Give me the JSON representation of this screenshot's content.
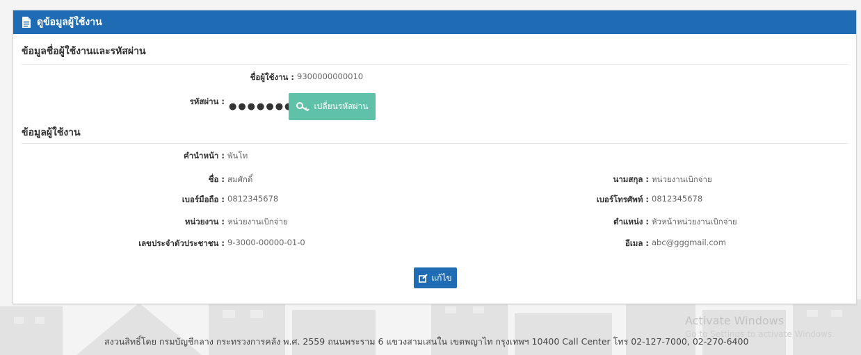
{
  "panel": {
    "title": "ดูข้อมูลผู้ใช้งาน"
  },
  "account_section": {
    "title": "ข้อมูลชื่อผู้ใช้งานและรหัสผ่าน",
    "username_label": "ชื่อผู้ใช้งาน :",
    "username_value": "9300000000010",
    "password_label": "รหัสผ่าน :",
    "password_mask": "●●●●●●●●",
    "change_password_button": "เปลี่ยนรหัสผ่าน"
  },
  "user_section": {
    "title": "ข้อมูลผู้ใช้งาน",
    "title_label": "คำนำหน้า :",
    "title_value": "พันโท",
    "firstname_label": "ชื่อ :",
    "firstname_value": "สมศักดิ์",
    "lastname_label": "นามสกุล :",
    "lastname_value": "หน่วยงานเบิกจ่าย",
    "mobile_label": "เบอร์มือถือ :",
    "mobile_value": "0812345678",
    "phone_label": "เบอร์โทรศัพท์ :",
    "phone_value": "0812345678",
    "agency_label": "หน่วยงาน :",
    "agency_value": "หน่วยงานเบิกจ่าย",
    "position_label": "ตำแหน่ง :",
    "position_value": "หัวหน้าหน่วยงานเบิกจ่าย",
    "citizen_id_label": "เลขประจำตัวประชาชน :",
    "citizen_id_value": "9-3000-00000-01-0",
    "email_label": "อีเมล :",
    "email_value": "abc@gggmail.com"
  },
  "edit_button": "แก้ไข",
  "footer": {
    "text": "สงวนสิทธิ์โดย กรมบัญชีกลาง กระทรวงการคลัง พ.ศ. 2559 ถนนพระราม 6 แขวงสามเสนใน เขตพญาไท กรุงเทพฯ 10400 Call Center โทร 02-127-7000, 02-270-6400"
  },
  "watermark": {
    "line1": "Activate Windows",
    "line2": "Go to Settings to activate Windows."
  },
  "colors": {
    "header": "#1f6cb5",
    "change_button": "#5fc2a8",
    "edit_button": "#1f6cb5"
  }
}
